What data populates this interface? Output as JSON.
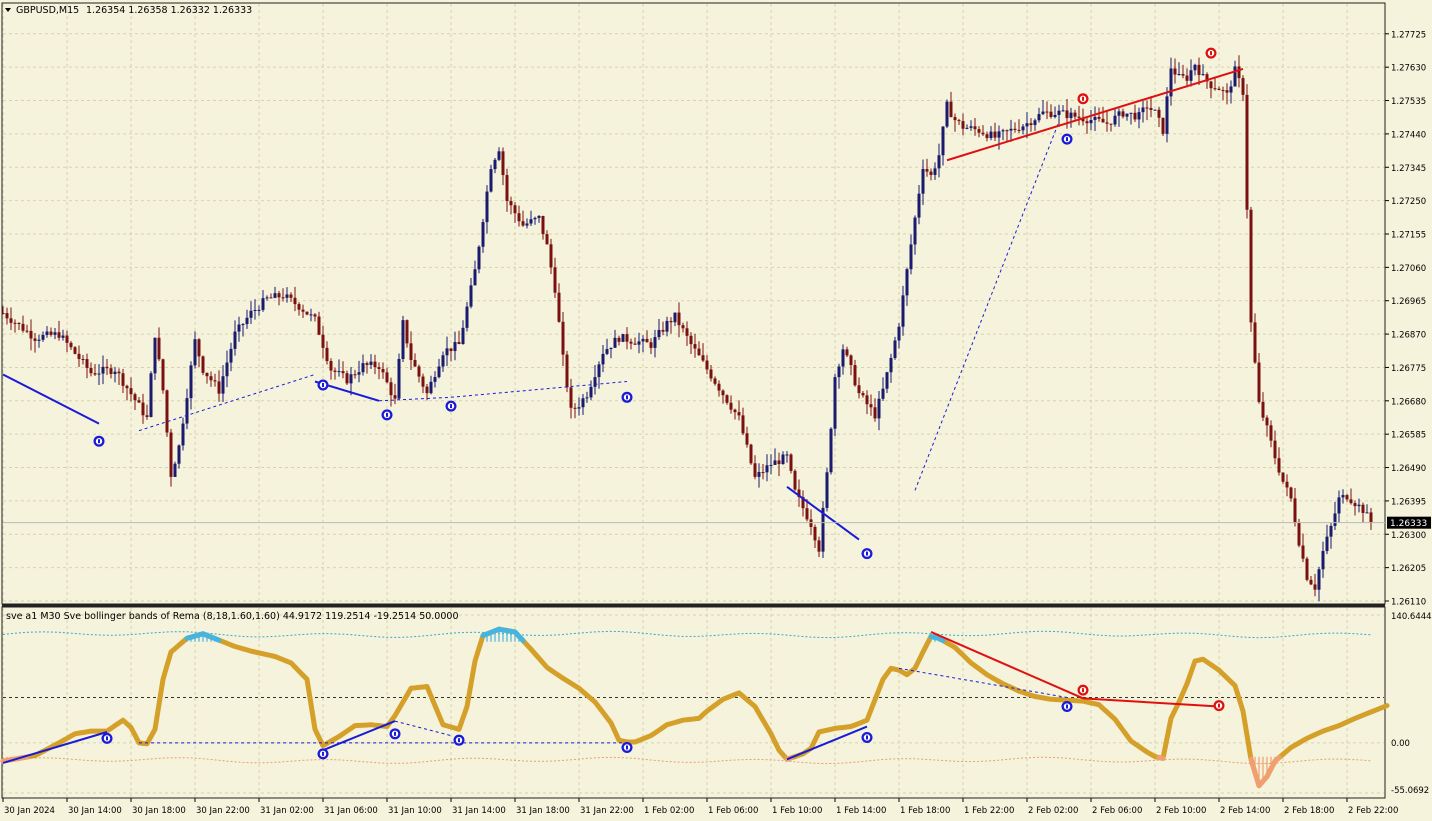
{
  "header": {
    "symbol_label": "GBPUSD,M15",
    "ohlc_label": "1.26354 1.26358 1.26332 1.26333",
    "indicator_label": "sve a1 M30 Sve bollinger bands of Rema (8,18,1.60,1.60) 44.9172 119.2514 -19.2514 50.0000"
  },
  "colors": {
    "background": "#f5f3dc",
    "grid": "#d8d3ae",
    "bull_candle": "#1a1a6e",
    "bear_candle": "#7a1010",
    "upper_band": "#3aa6c8",
    "lower_band": "#e8a070",
    "oscillator": "#d4a02a",
    "osc_hot": "#47b4e0",
    "osc_cold": "#f0a070",
    "bull_divergence": "#1a1ad8",
    "bear_divergence": "#e01010",
    "arrow_up": "#1a1ad8",
    "arrow_down": "#e01010"
  },
  "icons": {
    "buy_signal": "up-arrow-circle-icon",
    "sell_signal": "down-arrow-circle-icon"
  },
  "chart_data": [
    {
      "type": "candlestick",
      "title": "GBPUSD,M15",
      "ylim": [
        1.2611,
        1.2782
      ],
      "y_ticks": [
        "1.27725",
        "1.27630",
        "1.27535",
        "1.27440",
        "1.27345",
        "1.27250",
        "1.27155",
        "1.27060",
        "1.26965",
        "1.26870",
        "1.26775",
        "1.26680",
        "1.26585",
        "1.26490",
        "1.26395",
        "1.26300",
        "1.26205",
        "1.26110"
      ],
      "current_price": "1.26333",
      "x_ticks": [
        "30 Jan 2024",
        "30 Jan 14:00",
        "30 Jan 18:00",
        "30 Jan 22:00",
        "31 Jan 02:00",
        "31 Jan 06:00",
        "31 Jan 10:00",
        "31 Jan 14:00",
        "31 Jan 18:00",
        "31 Jan 22:00",
        "1 Feb 02:00",
        "1 Feb 06:00",
        "1 Feb 10:00",
        "1 Feb 14:00",
        "1 Feb 18:00",
        "1 Feb 22:00",
        "2 Feb 02:00",
        "2 Feb 06:00",
        "2 Feb 10:00",
        "2 Feb 14:00",
        "2 Feb 18:00",
        "2 Feb 22:00"
      ],
      "price_path": [
        [
          0,
          1.2693
        ],
        [
          4,
          1.2686
        ],
        [
          7,
          1.2687
        ],
        [
          11,
          1.2676
        ],
        [
          14,
          1.2677
        ],
        [
          16,
          1.267
        ],
        [
          18,
          1.2663
        ],
        [
          19,
          1.2687
        ],
        [
          20,
          1.2671
        ],
        [
          21,
          1.2647
        ],
        [
          22,
          1.2655
        ],
        [
          24,
          1.2685
        ],
        [
          25,
          1.2677
        ],
        [
          27,
          1.2671
        ],
        [
          29,
          1.2687
        ],
        [
          31,
          1.2693
        ],
        [
          33,
          1.2697
        ],
        [
          35,
          1.2698
        ],
        [
          37,
          1.2695
        ],
        [
          39,
          1.2691
        ],
        [
          41,
          1.2677
        ],
        [
          43,
          1.2674
        ],
        [
          45,
          1.2678
        ],
        [
          47,
          1.2678
        ],
        [
          49,
          1.2668
        ],
        [
          50,
          1.269
        ],
        [
          51,
          1.268
        ],
        [
          52,
          1.2675
        ],
        [
          53,
          1.267
        ],
        [
          55,
          1.2682
        ],
        [
          57,
          1.2684
        ],
        [
          59,
          1.2705
        ],
        [
          60,
          1.272
        ],
        [
          61,
          1.2735
        ],
        [
          62,
          1.274
        ],
        [
          63,
          1.2725
        ],
        [
          65,
          1.2718
        ],
        [
          67,
          1.272
        ],
        [
          68,
          1.2712
        ],
        [
          69,
          1.27
        ],
        [
          70,
          1.268
        ],
        [
          71,
          1.2665
        ],
        [
          72,
          1.2667
        ],
        [
          73,
          1.267
        ],
        [
          75,
          1.2682
        ],
        [
          77,
          1.2686
        ],
        [
          79,
          1.2685
        ],
        [
          81,
          1.2684
        ],
        [
          83,
          1.269
        ],
        [
          84,
          1.2692
        ],
        [
          86,
          1.2684
        ],
        [
          88,
          1.2677
        ],
        [
          90,
          1.267
        ],
        [
          92,
          1.2663
        ],
        [
          94,
          1.2646
        ],
        [
          96,
          1.265
        ],
        [
          98,
          1.2652
        ],
        [
          99,
          1.2642
        ],
        [
          101,
          1.2633
        ],
        [
          102,
          1.2626
        ],
        [
          103,
          1.2647
        ],
        [
          104,
          1.2675
        ],
        [
          105,
          1.2683
        ],
        [
          106,
          1.2677
        ],
        [
          107,
          1.267
        ],
        [
          109,
          1.2664
        ],
        [
          110,
          1.2671
        ],
        [
          111,
          1.268
        ],
        [
          112,
          1.269
        ],
        [
          113,
          1.2705
        ],
        [
          114,
          1.272
        ],
        [
          115,
          1.2735
        ],
        [
          116,
          1.2732
        ],
        [
          117,
          1.2738
        ],
        [
          118,
          1.2752
        ],
        [
          119,
          1.2748
        ],
        [
          120,
          1.2746
        ],
        [
          122,
          1.2745
        ],
        [
          124,
          1.2743
        ],
        [
          126,
          1.2745
        ],
        [
          128,
          1.2747
        ],
        [
          130,
          1.275
        ],
        [
          132,
          1.275
        ],
        [
          134,
          1.2749
        ],
        [
          136,
          1.2748
        ],
        [
          138,
          1.2747
        ],
        [
          140,
          1.275
        ],
        [
          142,
          1.2749
        ],
        [
          143,
          1.2752
        ],
        [
          144,
          1.275
        ],
        [
          145,
          1.2745
        ],
        [
          146,
          1.2763
        ],
        [
          147,
          1.276
        ],
        [
          148,
          1.276
        ],
        [
          149,
          1.2764
        ],
        [
          150,
          1.276
        ],
        [
          151,
          1.2758
        ],
        [
          152,
          1.2757
        ],
        [
          153,
          1.2755
        ],
        [
          154,
          1.2762
        ],
        [
          155,
          1.2756
        ],
        [
          156,
          1.269
        ],
        [
          157,
          1.2667
        ],
        [
          158,
          1.266
        ],
        [
          159,
          1.2652
        ],
        [
          160,
          1.2645
        ],
        [
          161,
          1.264
        ],
        [
          162,
          1.2628
        ],
        [
          163,
          1.2618
        ],
        [
          164,
          1.2615
        ],
        [
          165,
          1.2625
        ],
        [
          166,
          1.2632
        ],
        [
          167,
          1.264
        ],
        [
          168,
          1.2641
        ],
        [
          169,
          1.2639
        ],
        [
          170,
          1.2637
        ],
        [
          171,
          1.26333
        ]
      ],
      "divergence_lines": [
        {
          "kind": "bull-regular",
          "from": [
            0,
            1.26755
          ],
          "to": [
            12,
            1.26615
          ]
        },
        {
          "kind": "bull-hidden",
          "from": [
            17,
            1.26595
          ],
          "to": [
            39,
            1.26755
          ]
        },
        {
          "kind": "bull-regular",
          "from": [
            39,
            1.26735
          ],
          "to": [
            47,
            1.2668
          ]
        },
        {
          "kind": "bull-hidden",
          "from": [
            47,
            1.2668
          ],
          "to": [
            56,
            1.2669
          ]
        },
        {
          "kind": "bull-hidden",
          "from": [
            56,
            1.2669
          ],
          "to": [
            78,
            1.26735
          ]
        },
        {
          "kind": "bull-regular",
          "from": [
            98,
            1.26435
          ],
          "to": [
            107,
            1.26285
          ]
        },
        {
          "kind": "bull-hidden",
          "from": [
            114,
            1.26425
          ],
          "to": [
            132,
            1.27475
          ]
        },
        {
          "kind": "bear-regular",
          "from": [
            118,
            1.27365
          ],
          "to": [
            155,
            1.27625
          ]
        }
      ],
      "signals": [
        {
          "kind": "buy",
          "at": [
            12,
            1.26565
          ]
        },
        {
          "kind": "buy",
          "at": [
            40,
            1.26725
          ]
        },
        {
          "kind": "buy",
          "at": [
            48,
            1.2664
          ]
        },
        {
          "kind": "buy",
          "at": [
            56,
            1.26665
          ]
        },
        {
          "kind": "buy",
          "at": [
            78,
            1.2669
          ]
        },
        {
          "kind": "buy",
          "at": [
            108,
            1.26245
          ]
        },
        {
          "kind": "buy",
          "at": [
            133,
            1.27425
          ]
        },
        {
          "kind": "sell",
          "at": [
            135,
            1.2754
          ]
        },
        {
          "kind": "sell",
          "at": [
            151,
            1.2767
          ]
        }
      ]
    },
    {
      "type": "line",
      "title": "sve a1 M30 Sve bollinger bands of Rema (8,18,1.60,1.60) 44.9172 119.2514 -19.2514 50.0000",
      "ylim": [
        -55.0692,
        140.6444
      ],
      "y_ticks": [
        "140.6444",
        "0.00",
        "-55.0692"
      ],
      "level_line": 50.0,
      "upper_band": 119.2514,
      "lower_band": -19.2514,
      "series_path": [
        [
          0,
          -20
        ],
        [
          4,
          -14
        ],
        [
          7,
          0
        ],
        [
          9,
          10
        ],
        [
          11,
          13
        ],
        [
          13,
          13
        ],
        [
          15,
          25
        ],
        [
          16,
          17
        ],
        [
          17,
          0
        ],
        [
          18,
          -1
        ],
        [
          19,
          15
        ],
        [
          20,
          70
        ],
        [
          21,
          100
        ],
        [
          23,
          115
        ],
        [
          25,
          120
        ],
        [
          27,
          113
        ],
        [
          29,
          106
        ],
        [
          31,
          101
        ],
        [
          34,
          95
        ],
        [
          36,
          88
        ],
        [
          38,
          70
        ],
        [
          39,
          15
        ],
        [
          40,
          -3
        ],
        [
          42,
          7
        ],
        [
          44,
          19
        ],
        [
          46,
          20
        ],
        [
          48,
          18
        ],
        [
          49,
          30
        ],
        [
          51,
          60
        ],
        [
          53,
          62
        ],
        [
          55,
          20
        ],
        [
          57,
          15
        ],
        [
          58,
          40
        ],
        [
          59,
          90
        ],
        [
          60,
          118
        ],
        [
          62,
          125
        ],
        [
          64,
          122
        ],
        [
          66,
          103
        ],
        [
          68,
          83
        ],
        [
          70,
          71
        ],
        [
          72,
          60
        ],
        [
          74,
          45
        ],
        [
          76,
          22
        ],
        [
          77,
          3
        ],
        [
          78,
          1
        ],
        [
          79,
          1
        ],
        [
          81,
          8
        ],
        [
          83,
          20
        ],
        [
          85,
          25
        ],
        [
          87,
          27
        ],
        [
          88,
          35
        ],
        [
          90,
          48
        ],
        [
          92,
          55
        ],
        [
          94,
          40
        ],
        [
          96,
          10
        ],
        [
          97,
          -8
        ],
        [
          98,
          -18
        ],
        [
          100,
          -12
        ],
        [
          101,
          -6
        ],
        [
          102,
          12
        ],
        [
          104,
          16
        ],
        [
          106,
          18
        ],
        [
          108,
          25
        ],
        [
          110,
          70
        ],
        [
          111,
          82
        ],
        [
          112,
          80
        ],
        [
          113,
          75
        ],
        [
          114,
          82
        ],
        [
          115,
          100
        ],
        [
          116,
          117
        ],
        [
          117,
          115
        ],
        [
          119,
          105
        ],
        [
          121,
          88
        ],
        [
          123,
          75
        ],
        [
          125,
          65
        ],
        [
          127,
          57
        ],
        [
          129,
          51
        ],
        [
          131,
          48
        ],
        [
          133,
          47
        ],
        [
          135,
          46
        ],
        [
          137,
          42
        ],
        [
          139,
          26
        ],
        [
          141,
          2
        ],
        [
          143,
          -10
        ],
        [
          144,
          -15
        ],
        [
          145,
          -17
        ],
        [
          146,
          27
        ],
        [
          147,
          45
        ],
        [
          148,
          65
        ],
        [
          149,
          90
        ],
        [
          150,
          92
        ],
        [
          152,
          80
        ],
        [
          154,
          63
        ],
        [
          155,
          35
        ],
        [
          156,
          -18
        ],
        [
          157,
          -47
        ],
        [
          158,
          -37
        ],
        [
          159,
          -20
        ],
        [
          161,
          -5
        ],
        [
          163,
          5
        ],
        [
          165,
          13
        ],
        [
          167,
          19
        ],
        [
          169,
          27
        ],
        [
          171,
          34
        ],
        [
          173,
          41
        ]
      ],
      "divergence_lines": [
        {
          "kind": "bull-regular",
          "from": [
            0,
            -22
          ],
          "to": [
            13,
            12
          ]
        },
        {
          "kind": "bull-hidden",
          "from": [
            17,
            0
          ],
          "to": [
            78,
            0
          ]
        },
        {
          "kind": "bull-regular",
          "from": [
            40,
            -8
          ],
          "to": [
            49,
            24
          ]
        },
        {
          "kind": "bull-hidden",
          "from": [
            49,
            24
          ],
          "to": [
            56,
            8
          ]
        },
        {
          "kind": "bull-regular",
          "from": [
            98,
            -18
          ],
          "to": [
            108,
            18
          ]
        },
        {
          "kind": "bull-hidden",
          "from": [
            112,
            82
          ],
          "to": [
            133,
            50
          ]
        },
        {
          "kind": "bear-regular",
          "from": [
            116,
            122
          ],
          "to": [
            135,
            49
          ]
        },
        {
          "kind": "bear-regular",
          "from": [
            135,
            49
          ],
          "to": [
            152,
            40
          ]
        }
      ],
      "signals": [
        {
          "kind": "buy",
          "at": [
            13,
            5
          ]
        },
        {
          "kind": "buy",
          "at": [
            40,
            -12
          ]
        },
        {
          "kind": "buy",
          "at": [
            49,
            10
          ]
        },
        {
          "kind": "buy",
          "at": [
            57,
            3
          ]
        },
        {
          "kind": "buy",
          "at": [
            78,
            -5
          ]
        },
        {
          "kind": "buy",
          "at": [
            108,
            6
          ]
        },
        {
          "kind": "buy",
          "at": [
            133,
            40
          ]
        },
        {
          "kind": "sell",
          "at": [
            135,
            58
          ]
        },
        {
          "kind": "sell",
          "at": [
            152,
            41
          ]
        }
      ]
    }
  ]
}
